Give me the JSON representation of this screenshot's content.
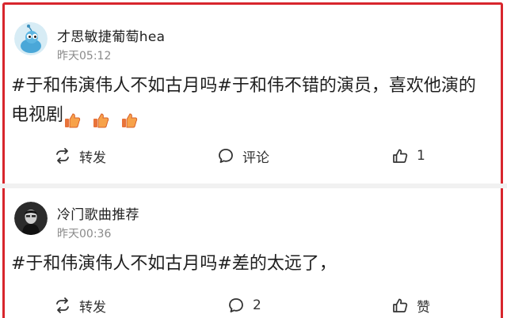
{
  "posts": [
    {
      "username": "才思敏捷葡萄hea",
      "time": "昨天05:12",
      "text_line1": "#于和伟演伟人不如古月吗#于和伟不错的演员，喜欢他演的",
      "text_line2": "电视剧",
      "emoji_count": 3,
      "actions": {
        "repost": "转发",
        "comment": "评论",
        "like": "1"
      }
    },
    {
      "username": "冷门歌曲推荐",
      "time": "昨天00:36",
      "text_line1": "#于和伟演伟人不如古月吗#差的太远了，",
      "actions": {
        "repost": "转发",
        "comment": "2",
        "like": "赞"
      }
    }
  ],
  "icons": {
    "repost": "repost-icon",
    "comment": "comment-icon",
    "like": "thumbs-up-icon",
    "emoji": "thumbs-up-emoji-icon"
  },
  "colors": {
    "highlight_border": "#d8262d",
    "time": "#8a8a8a"
  }
}
